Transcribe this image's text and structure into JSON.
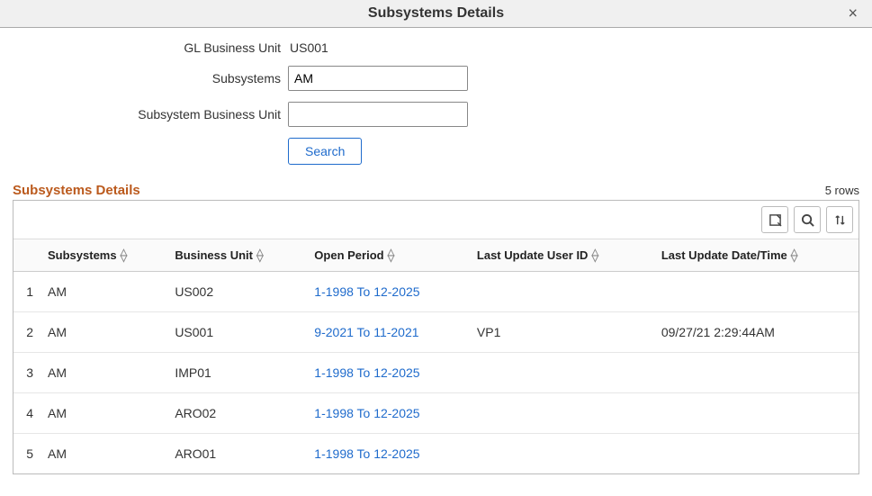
{
  "modal": {
    "title": "Subsystems Details"
  },
  "form": {
    "gl_bu_label": "GL Business Unit",
    "gl_bu_value": "US001",
    "subsystems_label": "Subsystems",
    "subsystems_value": "AM",
    "sub_bu_label": "Subsystem Business Unit",
    "sub_bu_value": "",
    "search_label": "Search"
  },
  "grid": {
    "section_title": "Subsystems Details",
    "row_count_text": "5 rows",
    "columns": {
      "subsystems": "Subsystems",
      "business_unit": "Business Unit",
      "open_period": "Open Period",
      "last_update_user": "Last Update User ID",
      "last_update_dttm": "Last Update Date/Time"
    },
    "rows": [
      {
        "n": "1",
        "subsystems": "AM",
        "business_unit": "US002",
        "open_period": "1-1998 To 12-2025",
        "last_update_user": "",
        "last_update_dttm": ""
      },
      {
        "n": "2",
        "subsystems": "AM",
        "business_unit": "US001",
        "open_period": "9-2021 To 11-2021",
        "last_update_user": "VP1",
        "last_update_dttm": "09/27/21  2:29:44AM"
      },
      {
        "n": "3",
        "subsystems": "AM",
        "business_unit": "IMP01",
        "open_period": "1-1998 To 12-2025",
        "last_update_user": "",
        "last_update_dttm": ""
      },
      {
        "n": "4",
        "subsystems": "AM",
        "business_unit": "ARO02",
        "open_period": "1-1998 To 12-2025",
        "last_update_user": "",
        "last_update_dttm": ""
      },
      {
        "n": "5",
        "subsystems": "AM",
        "business_unit": "ARO01",
        "open_period": "1-1998 To 12-2025",
        "last_update_user": "",
        "last_update_dttm": ""
      }
    ]
  }
}
